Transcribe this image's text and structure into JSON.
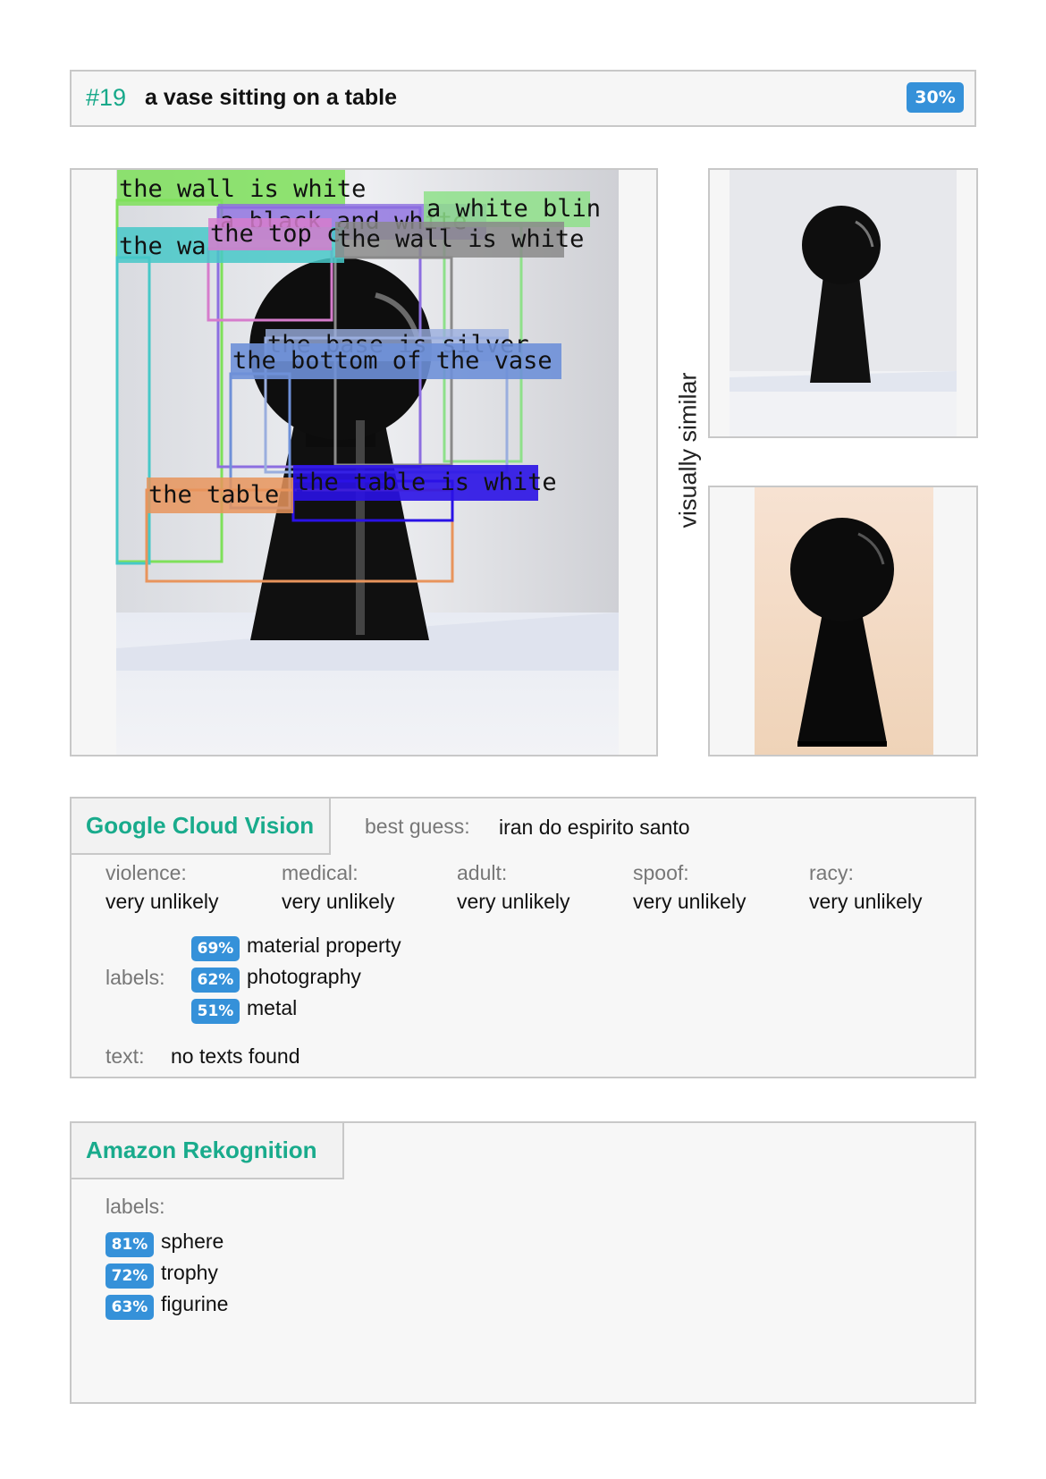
{
  "header": {
    "number": "#19",
    "caption": "a vase sitting on a table",
    "score": "30%"
  },
  "annotations": [
    {
      "text": "the wall is white",
      "color": "#7ee05a"
    },
    {
      "text": "a black and white",
      "color": "#8c6ee0"
    },
    {
      "text": "a white blin",
      "color": "#8ee08a"
    },
    {
      "text": "the wa",
      "color": "#46c8c8"
    },
    {
      "text": "the top c",
      "color": "#d67ccc"
    },
    {
      "text": "the wall is white",
      "color": "#8a8a8a"
    },
    {
      "text": "the base is silver",
      "color": "#9aaede"
    },
    {
      "text": "the bottom of the vase",
      "color": "#6e90d8"
    },
    {
      "text": "the table i",
      "color": "#e8945c"
    },
    {
      "text": "the table is white",
      "color": "#2a12e6"
    }
  ],
  "similar_label": "visually similar",
  "gcv": {
    "title": "Google Cloud Vision",
    "best_guess_label": "best guess:",
    "best_guess": "iran do espirito santo",
    "safe": [
      {
        "key": "violence:",
        "value": "very unlikely"
      },
      {
        "key": "medical:",
        "value": "very unlikely"
      },
      {
        "key": "adult:",
        "value": "very unlikely"
      },
      {
        "key": "spoof:",
        "value": "very unlikely"
      },
      {
        "key": "racy:",
        "value": "very unlikely"
      }
    ],
    "labels_title": "labels:",
    "labels": [
      {
        "pct": "69%",
        "name": "material property"
      },
      {
        "pct": "62%",
        "name": "photography"
      },
      {
        "pct": "51%",
        "name": "metal"
      }
    ],
    "text_label": "text:",
    "text_value": "no texts found"
  },
  "aws": {
    "title": "Amazon Rekognition",
    "labels_title": "labels:",
    "labels": [
      {
        "pct": "81%",
        "name": "sphere"
      },
      {
        "pct": "72%",
        "name": "trophy"
      },
      {
        "pct": "63%",
        "name": "figurine"
      }
    ]
  },
  "colors": {
    "accent": "#17a98a",
    "badge": "#3591d9"
  }
}
